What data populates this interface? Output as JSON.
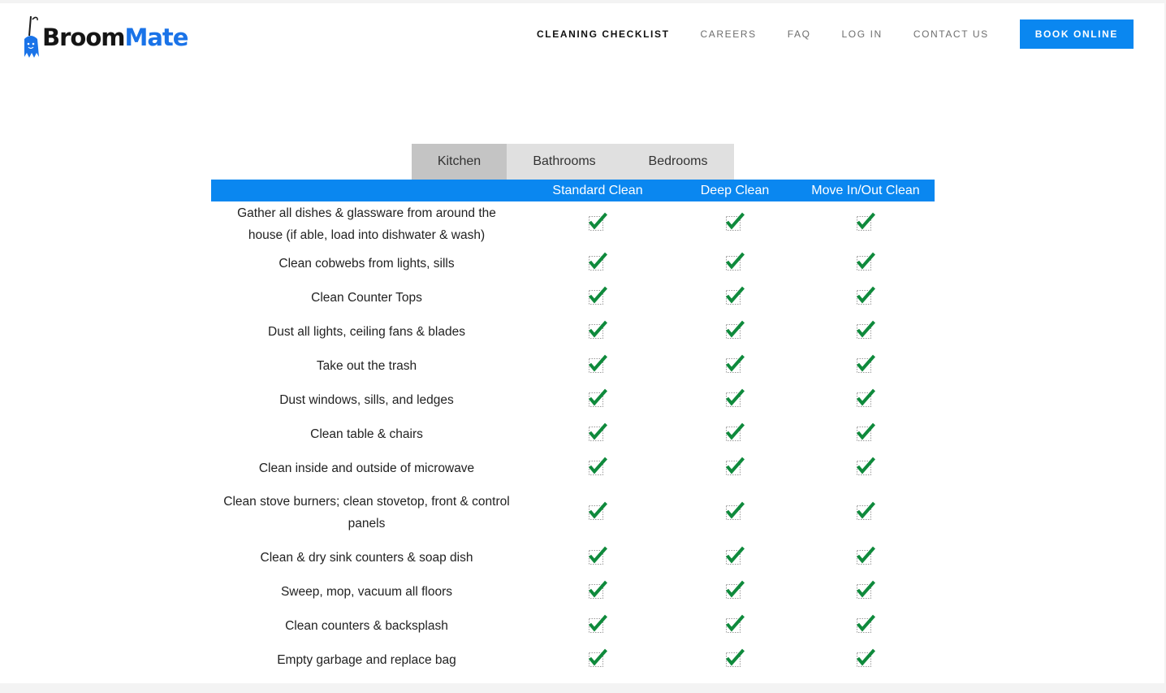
{
  "brand": {
    "part1": "Broom",
    "part2": "Mate"
  },
  "nav": {
    "items": [
      "CLEANING CHECKLIST",
      "CAREERS",
      "FAQ",
      "LOG IN",
      "CONTACT US"
    ],
    "cta": "BOOK ONLINE"
  },
  "tabs": [
    "Kitchen",
    "Bathrooms",
    "Bedrooms"
  ],
  "table": {
    "columns": [
      "",
      "Standard Clean",
      "Deep Clean",
      "Move In/Out Clean"
    ],
    "rows": [
      "Gather all dishes & glassware from around the house (if able, load into dishwater & wash)",
      "Clean cobwebs from lights, sills",
      "Clean Counter Tops",
      "Dust all lights, ceiling fans & blades",
      "Take out the trash",
      "Dust windows, sills, and ledges",
      "Clean table & chairs",
      "Clean inside and outside of microwave",
      "Clean stove burners; clean stovetop, front & control panels",
      "Clean & dry sink counters & soap dish",
      "Sweep, mop, vacuum all floors",
      "Clean counters & backsplash",
      "Empty garbage and replace bag"
    ]
  },
  "colors": {
    "accent": "#0a87f0",
    "check": "#0f8a3c",
    "logo_blue": "#1a73e8"
  },
  "icons": {
    "check": "checkmark-icon",
    "logo": "broom-mascot-icon"
  }
}
